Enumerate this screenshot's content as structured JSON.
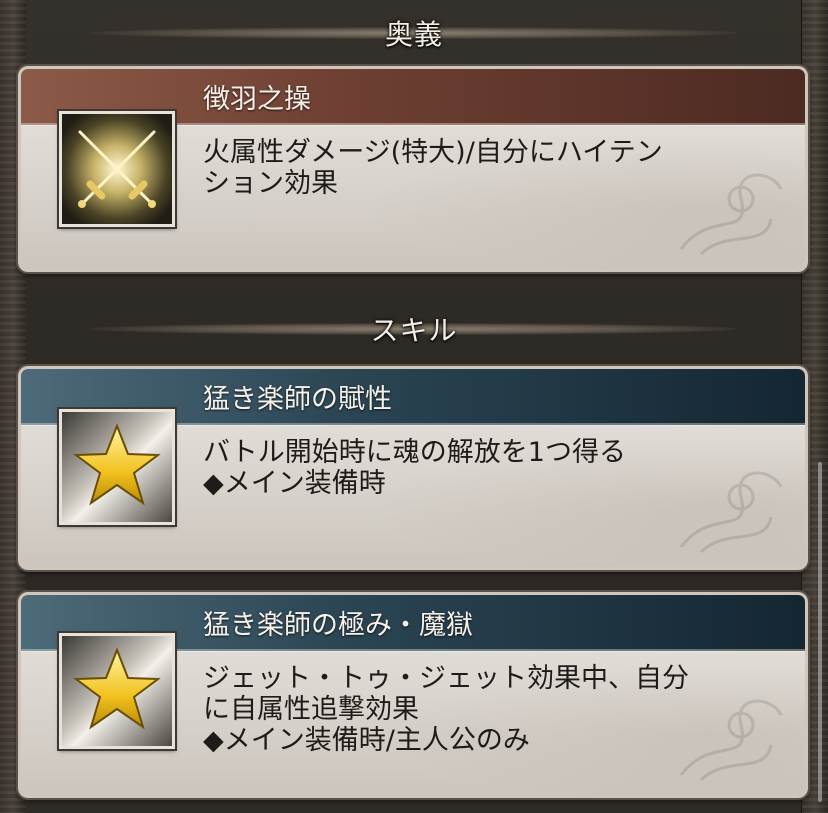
{
  "sections": {
    "ougi": {
      "title": "奥義"
    },
    "skill": {
      "title": "スキル"
    }
  },
  "ougi_card": {
    "icon": "crossed-swords-icon",
    "name": "徴羽之操",
    "desc_lines": [
      "火属性ダメージ(特大)/自分にハイテン",
      "ション効果"
    ]
  },
  "skills": [
    {
      "icon": "star-icon",
      "name": "猛き楽師の賦性",
      "desc_lines": [
        "バトル開始時に魂の解放を1つ得る",
        "◆メイン装備時"
      ]
    },
    {
      "icon": "star-icon",
      "name": "猛き楽師の極み・魔獄",
      "desc_lines": [
        "ジェット・トゥ・ジェット効果中、自分",
        "に自属性追撃効果",
        "◆メイン装備時/主人公のみ"
      ]
    }
  ],
  "colors": {
    "ougi_band": "#6f4033",
    "skill_band": "#2c4654",
    "card_bg": "#e0dcd5"
  }
}
